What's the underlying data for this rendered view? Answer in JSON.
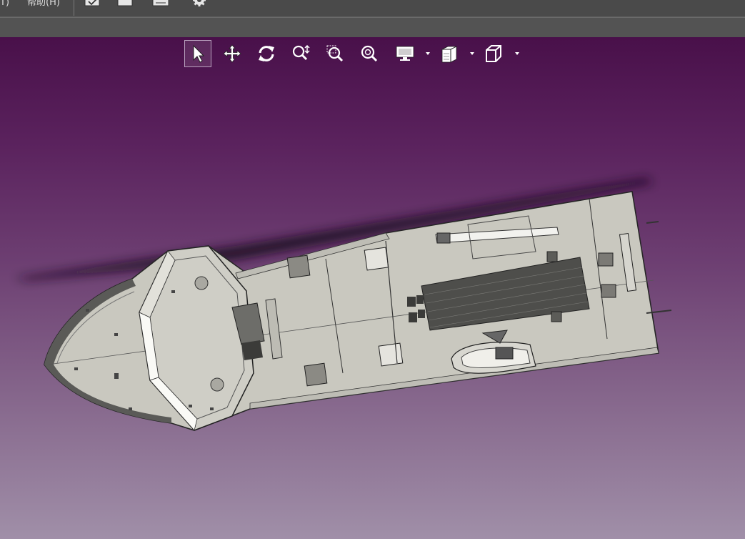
{
  "menubar": {
    "items": [
      {
        "label": "T)"
      },
      {
        "label": "帮助(H)"
      }
    ],
    "icons": [
      "open-file-icon",
      "save-icon",
      "print-icon",
      "settings-icon"
    ]
  },
  "view_toolbar": {
    "buttons": [
      {
        "icon": "select-arrow-icon",
        "active": true
      },
      {
        "icon": "pan-move-icon",
        "active": false
      },
      {
        "icon": "rotate-icon",
        "active": false
      },
      {
        "icon": "zoom-dynamic-icon",
        "active": false
      },
      {
        "icon": "zoom-window-icon",
        "active": false
      },
      {
        "icon": "zoom-fit-icon",
        "active": false
      },
      {
        "icon": "display-mode-icon",
        "has_dropdown": true
      },
      {
        "icon": "section-view-icon",
        "has_dropdown": true
      },
      {
        "icon": "standard-views-cube-icon",
        "has_dropdown": true
      }
    ]
  },
  "colors": {
    "viewport_top": "#49104a",
    "viewport_bottom": "#a08fa8",
    "model_fill": "#c9c8bf",
    "model_line": "#2a2a2a"
  }
}
